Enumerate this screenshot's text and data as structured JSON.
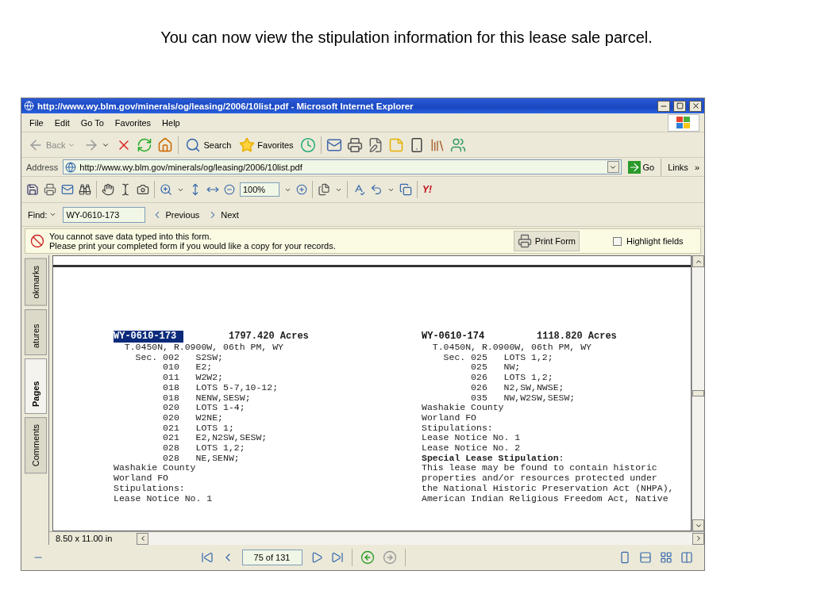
{
  "slide_title": "You can now view the stipulation information for this lease sale parcel.",
  "window": {
    "title": "http://www.wy.blm.gov/minerals/og/leasing/2006/10list.pdf - Microsoft Internet Explorer"
  },
  "menu": [
    "File",
    "Edit",
    "Go To",
    "Favorites",
    "Help"
  ],
  "toolbar": {
    "back": "Back",
    "search": "Search",
    "favorites": "Favorites"
  },
  "address": {
    "label": "Address",
    "url": "http://www.wy.blm.gov/minerals/og/leasing/2006/10list.pdf",
    "go": "Go",
    "links": "Links",
    "links_more": "»"
  },
  "pdf_toolbar": {
    "zoom": "100%",
    "logo": "Y!"
  },
  "find": {
    "label": "Find:",
    "value": "WY-0610-173",
    "previous": "Previous",
    "next": "Next"
  },
  "form_notice": {
    "lines": [
      "You cannot save data typed into this form.",
      "Please print your completed form if you would like a copy for your records."
    ],
    "print": "Print Form",
    "highlight": {
      "label": "Highlight fields",
      "checked": false
    }
  },
  "side_tabs": [
    {
      "label": "okmarks",
      "selected": false
    },
    {
      "label": "atures",
      "selected": false
    },
    {
      "label": "Pages",
      "selected": true
    },
    {
      "label": "Comments",
      "selected": false
    }
  ],
  "document": {
    "parcels": [
      {
        "id": "WY-0610-173",
        "id_selected": true,
        "acres": "1797.420 Acres",
        "lines": [
          {
            "kind": "township",
            "text": "T.0450N, R.0900W, 06th PM, WY"
          },
          {
            "kind": "section",
            "prefix": "Sec.",
            "number": "002",
            "desc": "S2SW;"
          },
          {
            "kind": "section",
            "number": "010",
            "desc": "E2;"
          },
          {
            "kind": "section",
            "number": "011",
            "desc": "W2W2;"
          },
          {
            "kind": "section",
            "number": "018",
            "desc": "LOTS 5-7,10-12;"
          },
          {
            "kind": "section",
            "number": "018",
            "desc": "NENW,SESW;"
          },
          {
            "kind": "section",
            "number": "020",
            "desc": "LOTS 1-4;"
          },
          {
            "kind": "section",
            "number": "020",
            "desc": "W2NE;"
          },
          {
            "kind": "section",
            "number": "021",
            "desc": "LOTS 1;"
          },
          {
            "kind": "section",
            "number": "021",
            "desc": "E2,N2SW,SESW;"
          },
          {
            "kind": "section",
            "number": "028",
            "desc": "LOTS 1,2;"
          },
          {
            "kind": "section",
            "number": "028",
            "desc": "NE,SENW;"
          },
          {
            "kind": "text",
            "text": "Washakie County"
          },
          {
            "kind": "text",
            "text": "Worland FO"
          },
          {
            "kind": "text",
            "text": "Stipulations:"
          },
          {
            "kind": "text",
            "text": "Lease Notice No. 1"
          }
        ]
      },
      {
        "id": "WY-0610-174",
        "id_selected": false,
        "acres": "1118.820 Acres",
        "lines": [
          {
            "kind": "township",
            "text": "T.0450N, R.0900W, 06th PM, WY"
          },
          {
            "kind": "section",
            "prefix": "Sec.",
            "number": "025",
            "desc": "LOTS 1,2;"
          },
          {
            "kind": "section",
            "number": "025",
            "desc": "NW;"
          },
          {
            "kind": "section",
            "number": "026",
            "desc": "LOTS 1,2;"
          },
          {
            "kind": "section",
            "number": "026",
            "desc": "N2,SW,NWSE;"
          },
          {
            "kind": "section",
            "number": "035",
            "desc": "NW,W2SW,SESW;"
          },
          {
            "kind": "text",
            "text": "Washakie County"
          },
          {
            "kind": "text",
            "text": "Worland FO"
          },
          {
            "kind": "text",
            "text": "Stipulations:"
          },
          {
            "kind": "text",
            "text": "Lease Notice No. 1"
          },
          {
            "kind": "text",
            "text": "Lease Notice No. 2"
          },
          {
            "kind": "text",
            "text": "**Special Lease Stipulation**:"
          },
          {
            "kind": "text",
            "text": "This lease may be found to contain historic"
          },
          {
            "kind": "text",
            "text": "properties and/or resources protected under"
          },
          {
            "kind": "text",
            "text": "the National Historic Preservation Act (NHPA),"
          },
          {
            "kind": "text",
            "text": "American Indian Religious Freedom Act, Native"
          }
        ]
      }
    ]
  },
  "page_size": "8.50 x 11.00 in",
  "navigation": {
    "page": "75 of 131"
  }
}
